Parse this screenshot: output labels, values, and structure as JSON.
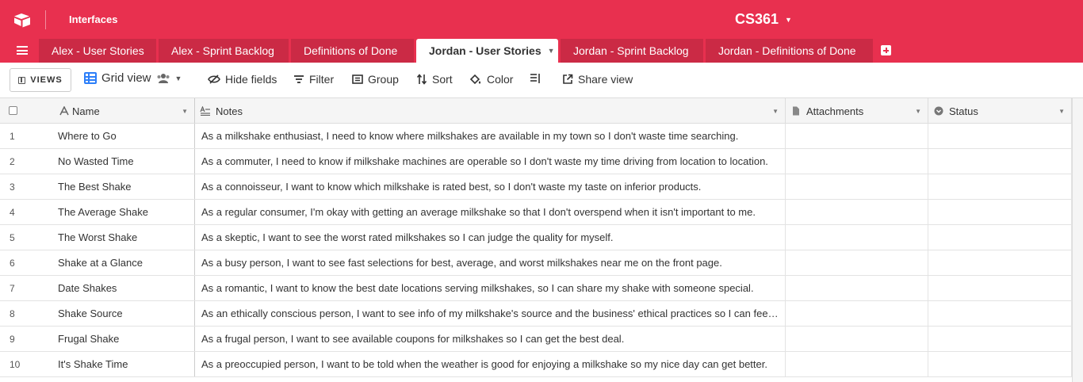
{
  "app": {
    "interfaces_label": "Interfaces",
    "base_name": "CS361",
    "brand_color": "#e8304f"
  },
  "tabs": [
    {
      "label": "Alex - User Stories",
      "active": false
    },
    {
      "label": "Alex - Sprint Backlog",
      "active": false
    },
    {
      "label": "Definitions of Done",
      "active": false
    },
    {
      "label": "Jordan - User Stories",
      "active": true
    },
    {
      "label": "Jordan - Sprint Backlog",
      "active": false
    },
    {
      "label": "Jordan - Definitions of Done",
      "active": false
    }
  ],
  "toolbar": {
    "views_label": "VIEWS",
    "view_name": "Grid view",
    "hide_fields": "Hide fields",
    "filter": "Filter",
    "group": "Group",
    "sort": "Sort",
    "color": "Color",
    "share_view": "Share view"
  },
  "columns": {
    "name": "Name",
    "notes": "Notes",
    "attachments": "Attachments",
    "status": "Status"
  },
  "rows": [
    {
      "num": "1",
      "name": "Where to Go",
      "notes": "As a milkshake enthusiast, I need to know where milkshakes are available in my town so I don't waste time searching.",
      "attachments": "",
      "status": ""
    },
    {
      "num": "2",
      "name": "No Wasted Time",
      "notes": "As a commuter, I need to know if milkshake machines are operable so I don't waste my time driving from location to location.",
      "attachments": "",
      "status": ""
    },
    {
      "num": "3",
      "name": "The Best Shake",
      "notes": "As a connoisseur, I want to know which milkshake is rated best, so I don't waste my taste on inferior products.",
      "attachments": "",
      "status": ""
    },
    {
      "num": "4",
      "name": "The Average Shake",
      "notes": "As a regular consumer, I'm okay with getting an average milkshake so that I don't overspend when it isn't important to me.",
      "attachments": "",
      "status": ""
    },
    {
      "num": "5",
      "name": "The Worst Shake",
      "notes": "As a skeptic, I want to see the worst rated milkshakes so I can judge the quality for myself.",
      "attachments": "",
      "status": ""
    },
    {
      "num": "6",
      "name": "Shake at a Glance",
      "notes": "As a busy person, I want to see fast selections for best, average, and worst milkshakes near me on the front page.",
      "attachments": "",
      "status": ""
    },
    {
      "num": "7",
      "name": "Date Shakes",
      "notes": "As a romantic, I want to know the best date locations serving milkshakes, so I can share my shake with someone special.",
      "attachments": "",
      "status": ""
    },
    {
      "num": "8",
      "name": "Shake Source",
      "notes": "As an ethically conscious person, I want to see info of my milkshake's source and the business' ethical practices so I can feel g…",
      "attachments": "",
      "status": ""
    },
    {
      "num": "9",
      "name": "Frugal Shake",
      "notes": "As a frugal person, I want to see available coupons for milkshakes so I can get the best deal.",
      "attachments": "",
      "status": ""
    },
    {
      "num": "10",
      "name": "It's Shake Time",
      "notes": "As a preoccupied person, I want to be told when the weather is good for enjoying a milkshake so my nice day can get better.",
      "attachments": "",
      "status": ""
    }
  ]
}
